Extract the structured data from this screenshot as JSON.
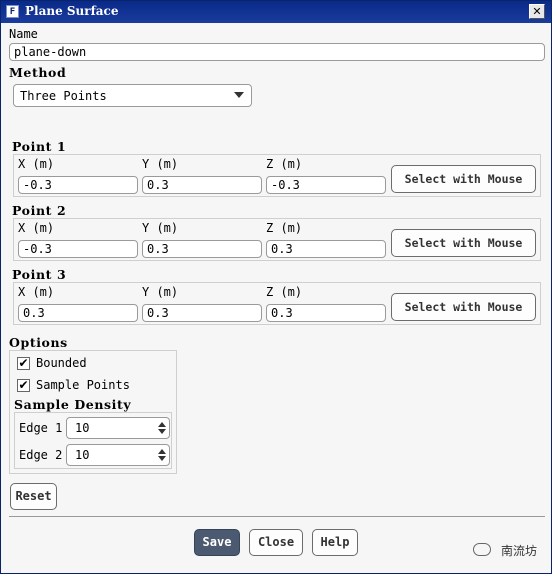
{
  "window": {
    "title": "Plane Surface",
    "icon_letter": "F",
    "close_glyph": "✕"
  },
  "name": {
    "label": "Name",
    "value": "plane-down"
  },
  "method": {
    "label": "Method",
    "selected": "Three Points"
  },
  "points": [
    {
      "label": "Point 1",
      "x_label": "X (m)",
      "y_label": "Y (m)",
      "z_label": "Z (m)",
      "x": "-0.3",
      "y": "0.3",
      "z": "-0.3",
      "button": "Select with Mouse"
    },
    {
      "label": "Point 2",
      "x_label": "X (m)",
      "y_label": "Y (m)",
      "z_label": "Z (m)",
      "x": "-0.3",
      "y": "0.3",
      "z": "0.3",
      "button": "Select with Mouse"
    },
    {
      "label": "Point 3",
      "x_label": "X (m)",
      "y_label": "Y (m)",
      "z_label": "Z (m)",
      "x": "0.3",
      "y": "0.3",
      "z": "0.3",
      "button": "Select with Mouse"
    }
  ],
  "options": {
    "label": "Options",
    "bounded": {
      "label": "Bounded",
      "checked": true,
      "mark": "✔"
    },
    "sample_points": {
      "label": "Sample Points",
      "checked": true,
      "mark": "✔"
    },
    "sample_density": {
      "label": "Sample Density",
      "edge1": {
        "label": "Edge 1",
        "value": "10"
      },
      "edge2": {
        "label": "Edge 2",
        "value": "10"
      }
    }
  },
  "reset_label": "Reset",
  "footer": {
    "save": "Save",
    "close": "Close",
    "help": "Help"
  },
  "watermark": {
    "text": "南流坊"
  }
}
